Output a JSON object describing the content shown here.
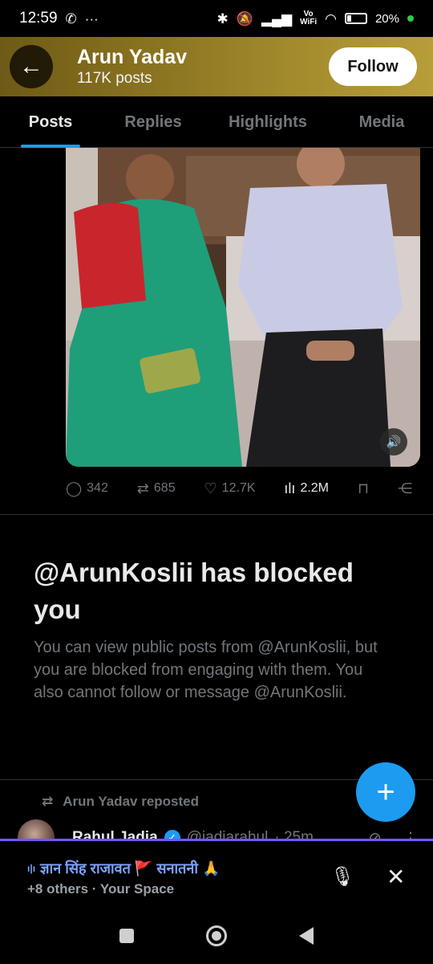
{
  "status_bar": {
    "time": "12:59",
    "battery": "20%",
    "vowifi_top": "Vo",
    "vowifi_bottom": "WiFi"
  },
  "header": {
    "name": "Arun Yadav",
    "posts_count": "117K posts",
    "follow_label": "Follow"
  },
  "tabs": [
    {
      "label": "Posts",
      "active": true
    },
    {
      "label": "Replies",
      "active": false
    },
    {
      "label": "Highlights",
      "active": false
    },
    {
      "label": "Media",
      "active": false
    }
  ],
  "post_actions": {
    "replies": "342",
    "reposts": "685",
    "likes": "12.7K",
    "views": "2.2M"
  },
  "blocked": {
    "title": "@ArunKoslii has blocked you",
    "description": "You can view public posts from @ArunKoslii, but you are blocked from engaging with them. You also cannot follow or message @ArunKoslii."
  },
  "repost": {
    "label": "Arun Yadav reposted",
    "author": "Rahul Jadia",
    "handle": "@jadiarahul",
    "time": "· 25m"
  },
  "space": {
    "title": "ज्ञान सिंह राजावत 🚩 सनातनी 🙏",
    "subtitle": "+8 others · Your Space"
  },
  "colors": {
    "accent": "#1d9bf0",
    "space_border": "#7856ff",
    "muted": "#71767b"
  },
  "icons": [
    "back-arrow-icon",
    "whatsapp-icon",
    "bluetooth-icon",
    "mute-icon",
    "signal-icon",
    "wifi-icon",
    "battery-icon",
    "reply-icon",
    "repost-icon",
    "like-icon",
    "views-icon",
    "bookmark-icon",
    "share-icon",
    "volume-icon",
    "plus-icon",
    "mic-off-icon",
    "close-icon"
  ]
}
